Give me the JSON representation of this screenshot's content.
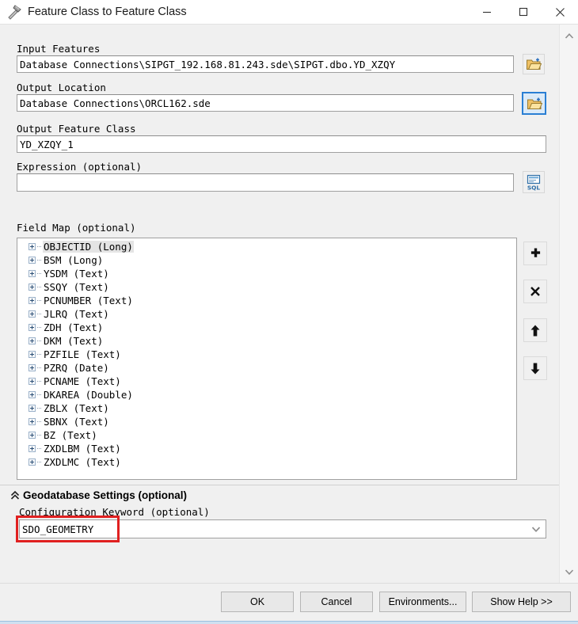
{
  "window": {
    "title": "Feature Class to Feature Class",
    "icon": "hammer-tool-icon",
    "controls": {
      "minimize": "—",
      "maximize": "□",
      "close": "✕"
    }
  },
  "form": {
    "input_features": {
      "label": "Input Features",
      "value": "Database Connections\\SIPGT_192.168.81.243.sde\\SIPGT.dbo.YD_XZQY",
      "browse_icon": "open-folder-icon"
    },
    "output_location": {
      "label": "Output Location",
      "value": "Database Connections\\ORCL162.sde",
      "browse_icon": "open-folder-icon"
    },
    "output_feature_class": {
      "label": "Output Feature Class",
      "value": "YD_XZQY_1"
    },
    "expression": {
      "label": "Expression (optional)",
      "value": "",
      "builder_icon": "sql-query-icon"
    },
    "field_map": {
      "label": "Field Map (optional)",
      "rows": [
        {
          "name": "OBJECTID",
          "type": "(Long)",
          "selected": true
        },
        {
          "name": "BSM",
          "type": "(Long)",
          "selected": false
        },
        {
          "name": "YSDM",
          "type": "(Text)",
          "selected": false
        },
        {
          "name": "SSQY",
          "type": "(Text)",
          "selected": false
        },
        {
          "name": "PCNUMBER",
          "type": "(Text)",
          "selected": false
        },
        {
          "name": "JLRQ",
          "type": "(Text)",
          "selected": false
        },
        {
          "name": "ZDH",
          "type": "(Text)",
          "selected": false
        },
        {
          "name": "DKM",
          "type": "(Text)",
          "selected": false
        },
        {
          "name": "PZFILE",
          "type": "(Text)",
          "selected": false
        },
        {
          "name": "PZRQ",
          "type": "(Date)",
          "selected": false
        },
        {
          "name": "PCNAME",
          "type": "(Text)",
          "selected": false
        },
        {
          "name": "DKAREA",
          "type": "(Double)",
          "selected": false
        },
        {
          "name": "ZBLX",
          "type": "(Text)",
          "selected": false
        },
        {
          "name": "SBNX",
          "type": "(Text)",
          "selected": false
        },
        {
          "name": "BZ",
          "type": "(Text)",
          "selected": false
        },
        {
          "name": "ZXDLBM",
          "type": "(Text)",
          "selected": false
        },
        {
          "name": "ZXDLMC",
          "type": "(Text)",
          "selected": false
        }
      ],
      "tools": [
        {
          "name": "add-field-button",
          "icon": "plus-icon"
        },
        {
          "name": "delete-field-button",
          "icon": "cross-icon"
        },
        {
          "name": "move-field-up-button",
          "icon": "arrow-up-icon"
        },
        {
          "name": "move-field-down-button",
          "icon": "arrow-down-icon"
        }
      ]
    },
    "geodatabase_settings": {
      "header": "Geodatabase Settings (optional)",
      "collapse_icon": "double-chevron-up-icon",
      "configuration_keyword": {
        "label": "Configuration Keyword (optional)",
        "value": "SDO_GEOMETRY",
        "dropdown_icon": "chevron-down-icon",
        "highlight_color": "#e02020"
      }
    }
  },
  "scrollbar": {
    "up_icon": "chevron-up-icon",
    "down_icon": "chevron-down-icon"
  },
  "buttons": {
    "ok": "OK",
    "cancel": "Cancel",
    "environments": "Environments...",
    "show_help": "Show Help >>"
  }
}
